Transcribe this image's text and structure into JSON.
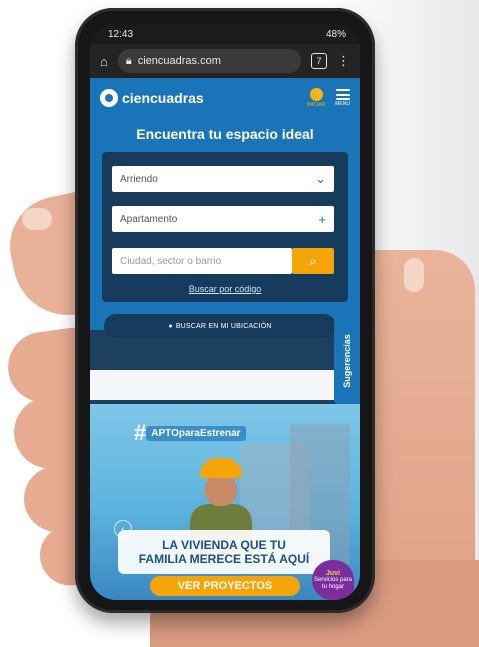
{
  "status_bar": {
    "time": "12:43",
    "battery": "48%"
  },
  "browser": {
    "url": "ciencuadras.com",
    "tab_count": "7"
  },
  "header": {
    "logo": "ciencuadras",
    "buy_label": "INICIAR",
    "menu_label": "MENU"
  },
  "hero": {
    "title": "Encuentra tu espacio ideal",
    "operation_select": "Arriendo",
    "property_select": "Apartamento",
    "location_placeholder": "Ciudad, sector o barrio",
    "code_link": "Buscar por código",
    "location_button": "BUSCAR EN MI UBICACIÓN"
  },
  "side_tab": "Sugerencias",
  "banner": {
    "hashtag": "APTOparaEstrenar",
    "headline_line1": "LA VIVIENDA QUE TU",
    "headline_line2": "FAMILIA MERECE ESTÁ AQUÍ",
    "cta": "VER PROYECTOS",
    "chat_title": "Juvi",
    "chat_text": "Servicios para tu hogar"
  },
  "icons": [
    "home-icon",
    "lock-icon",
    "kebab-menu-icon",
    "chevron-down-icon",
    "plus-icon",
    "search-icon",
    "location-pin-icon",
    "hamburger-icon"
  ]
}
